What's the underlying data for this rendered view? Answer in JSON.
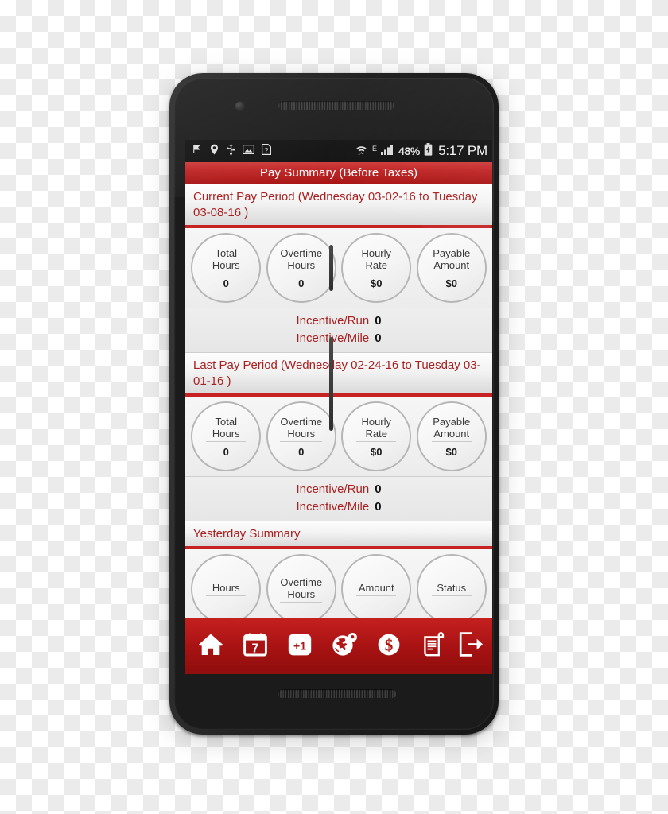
{
  "device": {
    "type": "smartphone",
    "body_color": "#222222"
  },
  "status_bar": {
    "left_icons": [
      "flag-icon",
      "location-pin-icon",
      "usb-icon",
      "image-icon",
      "unknown-file-icon"
    ],
    "wifi_icon": "wifi-icon",
    "network_type": "E",
    "signal_icon": "signal-bars-icon",
    "battery_percent": "48%",
    "battery_icon": "battery-charging-icon",
    "time": "5:17 PM"
  },
  "title_bar": {
    "title": "Pay Summary (Before Taxes)"
  },
  "sections": [
    {
      "id": "current-pay-period",
      "header": "Current Pay Period (Wednesday 03-02-16 to Tuesday 03-08-16 )",
      "metrics": [
        {
          "label_line1": "Total",
          "label_line2": "Hours",
          "value": "0"
        },
        {
          "label_line1": "Overtime",
          "label_line2": "Hours",
          "value": "0"
        },
        {
          "label_line1": "Hourly",
          "label_line2": "Rate",
          "value": "$0"
        },
        {
          "label_line1": "Payable",
          "label_line2": "Amount",
          "value": "$0"
        }
      ],
      "incentives": [
        {
          "label": "Incentive/Run",
          "value": "0"
        },
        {
          "label": "Incentive/Mile",
          "value": "0"
        }
      ]
    },
    {
      "id": "last-pay-period",
      "header": "Last Pay Period (Wednesday 02-24-16 to Tuesday 03-01-16 )",
      "metrics": [
        {
          "label_line1": "Total",
          "label_line2": "Hours",
          "value": "0"
        },
        {
          "label_line1": "Overtime",
          "label_line2": "Hours",
          "value": "0"
        },
        {
          "label_line1": "Hourly",
          "label_line2": "Rate",
          "value": "$0"
        },
        {
          "label_line1": "Payable",
          "label_line2": "Amount",
          "value": "$0"
        }
      ],
      "incentives": [
        {
          "label": "Incentive/Run",
          "value": "0"
        },
        {
          "label": "Incentive/Mile",
          "value": "0"
        }
      ]
    },
    {
      "id": "yesterday-summary",
      "header": "Yesterday Summary",
      "metrics": [
        {
          "label_line1": "Hours",
          "label_line2": "",
          "value": ""
        },
        {
          "label_line1": "Overtime",
          "label_line2": "Hours",
          "value": ""
        },
        {
          "label_line1": "Amount",
          "label_line2": "",
          "value": ""
        },
        {
          "label_line1": "Status",
          "label_line2": "",
          "value": ""
        }
      ]
    }
  ],
  "bottom_nav": {
    "items": [
      {
        "icon": "home-icon",
        "label": "Home"
      },
      {
        "icon": "calendar-7-icon",
        "label": "Schedule"
      },
      {
        "icon": "calendar-plus-one-icon",
        "label": "Add Day"
      },
      {
        "icon": "globe-pin-icon",
        "label": "Map"
      },
      {
        "icon": "dollar-coin-icon",
        "label": "Pay"
      },
      {
        "icon": "scroll-report-icon",
        "label": "Reports"
      },
      {
        "icon": "logout-icon",
        "label": "Logout"
      }
    ]
  },
  "colors": {
    "brand_red": "#c62020",
    "header_text_red": "#aa1f1f",
    "screen_bg": "#ededed"
  }
}
